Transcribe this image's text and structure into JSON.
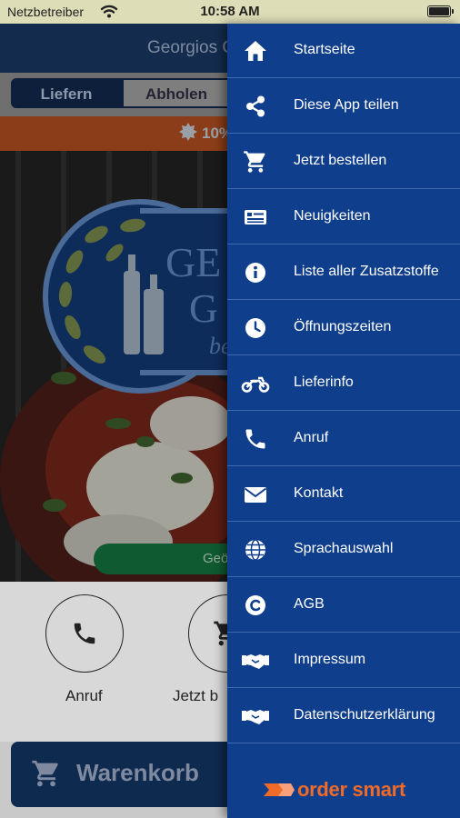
{
  "status_bar": {
    "carrier": "Netzbetreiber",
    "time": "10:58 AM"
  },
  "app": {
    "title": "Georgios G",
    "tabs": [
      {
        "label": "Liefern",
        "active": true
      },
      {
        "label": "Abholen",
        "active": false
      }
    ],
    "promo_text": "10%",
    "hero": {
      "logo_line1": "GE",
      "logo_line2": "G",
      "logo_line3": "be",
      "button_label": "Geö"
    },
    "actions": [
      {
        "label": "Anruf",
        "icon": "phone-icon"
      },
      {
        "label": "Jetzt b",
        "icon": "cart-icon"
      }
    ],
    "cart_button": "Warenkorb"
  },
  "drawer": {
    "items": [
      {
        "label": "Startseite",
        "icon": "home-icon"
      },
      {
        "label": "Diese App teilen",
        "icon": "share-icon"
      },
      {
        "label": "Jetzt bestellen",
        "icon": "cart-icon"
      },
      {
        "label": "Neuigkeiten",
        "icon": "news-icon"
      },
      {
        "label": "Liste aller Zusatzstoffe",
        "icon": "info-icon"
      },
      {
        "label": "Öffnungszeiten",
        "icon": "clock-icon"
      },
      {
        "label": "Lieferinfo",
        "icon": "motorcycle-icon"
      },
      {
        "label": "Anruf",
        "icon": "phone-icon"
      },
      {
        "label": "Kontakt",
        "icon": "mail-icon"
      },
      {
        "label": "Sprachauswahl",
        "icon": "globe-icon"
      },
      {
        "label": "AGB",
        "icon": "copyright-icon"
      },
      {
        "label": "Impressum",
        "icon": "handshake-icon"
      },
      {
        "label": "Datenschutzerklärung",
        "icon": "handshake-icon"
      }
    ],
    "brand": "order smart"
  },
  "colors": {
    "drawer_bg": "#0f3e8c",
    "drawer_divider": "#3f69ad",
    "brand_orange": "#f06a28",
    "header_dim": "#132c4e",
    "status_bar": "#ddddb8"
  }
}
